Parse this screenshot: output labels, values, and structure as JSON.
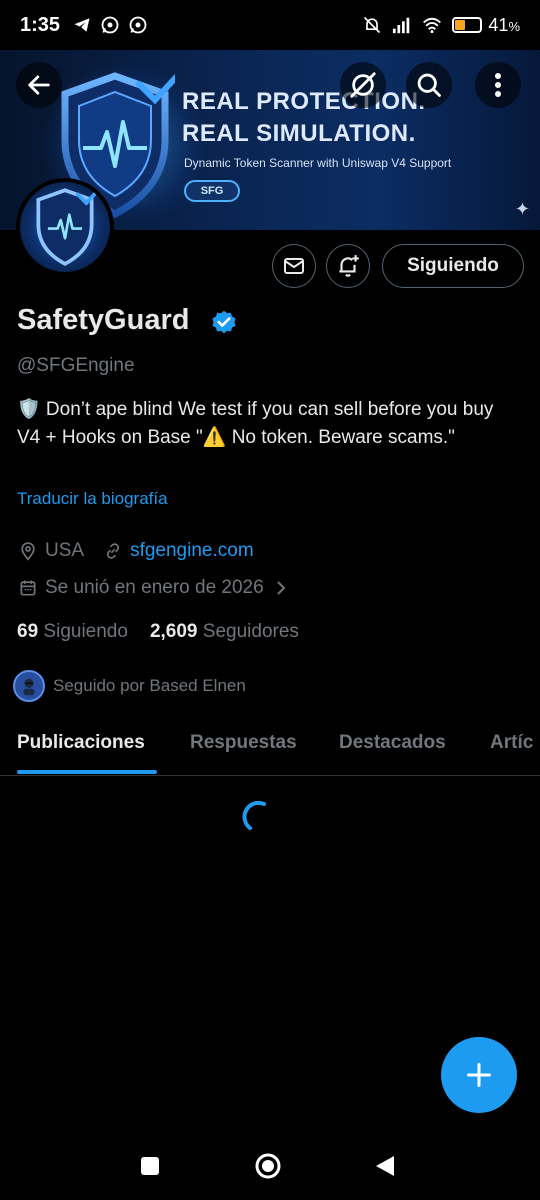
{
  "status_bar": {
    "time": "1:35",
    "battery_percent_text": "41",
    "battery_unit": "%",
    "battery_level": 0.41,
    "battery_color": "#f5a623",
    "left_icons": [
      "telegram-icon",
      "whatsapp-icon",
      "whatsapp-icon"
    ],
    "right_icons": [
      "mute-icon",
      "signal-icon",
      "wifi-icon",
      "battery-icon"
    ]
  },
  "banner": {
    "headline_line1": "REAL PROTECTION.",
    "headline_line2": "REAL SIMULATION.",
    "subtitle": "Dynamic Token Scanner with Uniswap V4 Support",
    "pill_label": "SFG"
  },
  "header_buttons": [
    "back-arrow-icon",
    "grok-icon",
    "search-icon",
    "more-icon"
  ],
  "profile": {
    "name": "SafetyGuard",
    "handle": "@SFGEngine",
    "bio": "🛡️ Don’t ape blind We test if you can sell before you buy V4 + Hooks on Base \"⚠️ No token. Beware scams.\"",
    "translate_label": "Traducir la biografía",
    "location": "USA",
    "website": "sfgengine.com",
    "joined": "Se unió en enero de 2026",
    "following_count": "69",
    "following_label": "Siguiendo",
    "followers_count": "2,609",
    "followers_label": "Seguidores",
    "followed_by": "Seguido por Based Elnen"
  },
  "actions": {
    "message_icon": "mail-icon",
    "notify_icon": "bell-plus-icon",
    "follow_label": "Siguiendo"
  },
  "tabs": [
    {
      "label": "Publicaciones",
      "active": true
    },
    {
      "label": "Respuestas",
      "active": false
    },
    {
      "label": "Destacados",
      "active": false
    },
    {
      "label": "Artíc",
      "active": false
    }
  ],
  "colors": {
    "accent": "#1d9bf0",
    "background": "#000000",
    "muted": "#71767b",
    "text": "#e7e9ea"
  }
}
